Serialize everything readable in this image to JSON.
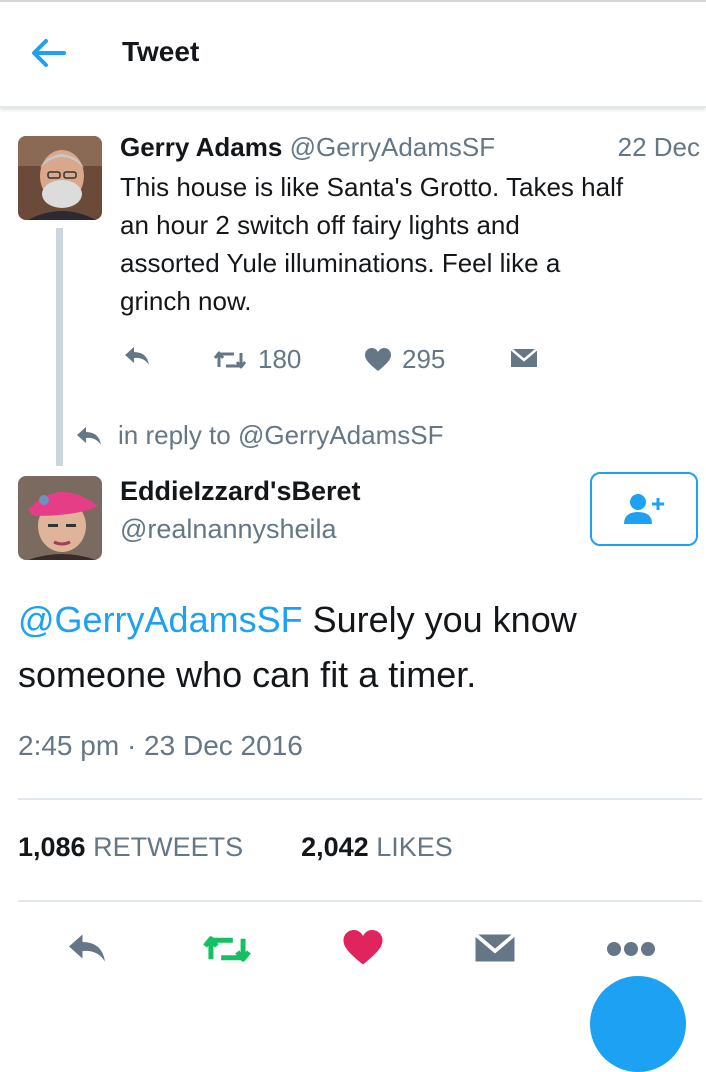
{
  "header": {
    "title": "Tweet"
  },
  "parent_tweet": {
    "name": "Gerry Adams",
    "handle": "@GerryAdamsSF",
    "date": "22 Dec",
    "lines": [
      "This house is like Santa's Grotto. Takes half",
      "an hour 2 switch off fairy lights and",
      "assorted Yule illuminations. Feel like a",
      "grinch now."
    ],
    "retweets": "180",
    "likes": "295"
  },
  "reply_to": {
    "text": "in reply to @GerryAdamsSF"
  },
  "main_tweet": {
    "name": "EddieIzzard'sBeret",
    "handle": "@realnannysheila",
    "mention": "@GerryAdamsSF",
    "text_rest_line1": " Surely you know",
    "text_line2": "someone who can fit a timer.",
    "timestamp": "2:45 pm · 23 Dec 2016",
    "retweet_count": "1,086",
    "retweet_label": "RETWEETS",
    "like_count": "2,042",
    "like_label": "LIKES"
  },
  "colors": {
    "accent": "#1da1f2",
    "muted": "#657786",
    "retweet_green": "#17bf63",
    "like_red": "#e0245e"
  },
  "icons": [
    "back-arrow-icon",
    "reply-icon",
    "retweet-icon",
    "heart-icon",
    "mail-icon",
    "follow-icon",
    "more-icon"
  ]
}
